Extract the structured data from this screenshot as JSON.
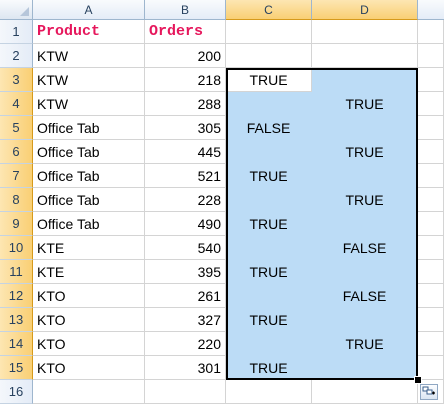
{
  "columns": [
    "A",
    "B",
    "C",
    "D"
  ],
  "rows": [
    "1",
    "2",
    "3",
    "4",
    "5",
    "6",
    "7",
    "8",
    "9",
    "10",
    "11",
    "12",
    "13",
    "14",
    "15",
    "16"
  ],
  "header": {
    "product": "Product",
    "orders": "Orders"
  },
  "data": [
    {
      "product": "KTW",
      "orders": "200",
      "c": "",
      "d": ""
    },
    {
      "product": "KTW",
      "orders": "218",
      "c": "TRUE",
      "d": ""
    },
    {
      "product": "KTW",
      "orders": "288",
      "c": "",
      "d": "TRUE"
    },
    {
      "product": "Office Tab",
      "orders": "305",
      "c": "FALSE",
      "d": ""
    },
    {
      "product": "Office Tab",
      "orders": "445",
      "c": "",
      "d": "TRUE"
    },
    {
      "product": "Office Tab",
      "orders": "521",
      "c": "TRUE",
      "d": ""
    },
    {
      "product": "Office Tab",
      "orders": "228",
      "c": "",
      "d": "TRUE"
    },
    {
      "product": "Office Tab",
      "orders": "490",
      "c": "TRUE",
      "d": ""
    },
    {
      "product": "KTE",
      "orders": "540",
      "c": "",
      "d": "FALSE"
    },
    {
      "product": "KTE",
      "orders": "395",
      "c": "TRUE",
      "d": ""
    },
    {
      "product": "KTO",
      "orders": "261",
      "c": "",
      "d": "FALSE"
    },
    {
      "product": "KTO",
      "orders": "327",
      "c": "TRUE",
      "d": ""
    },
    {
      "product": "KTO",
      "orders": "220",
      "c": "",
      "d": "TRUE"
    },
    {
      "product": "KTO",
      "orders": "301",
      "c": "TRUE",
      "d": ""
    }
  ],
  "colors": {
    "header_text": "#e6175c",
    "selection_fill": "#bcdcf6",
    "selected_header": "#f9cf74"
  },
  "icons": {
    "paste_options": "paste-options-icon"
  }
}
